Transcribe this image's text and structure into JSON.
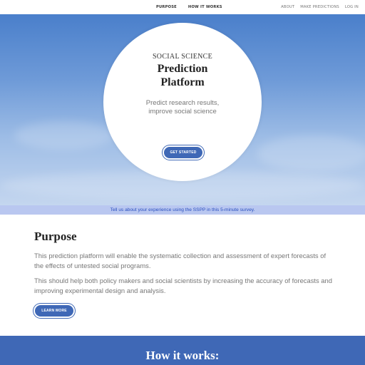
{
  "nav": {
    "center": [
      "PURPOSE",
      "HOW IT WORKS"
    ],
    "right": [
      "ABOUT",
      "MAKE PREDICTIONS",
      "LOG IN"
    ]
  },
  "hero": {
    "kicker": "SOCIAL SCIENCE",
    "title_line1": "Prediction",
    "title_line2": "Platform",
    "subtitle_line1": "Predict research results,",
    "subtitle_line2": "improve social science",
    "button": "GET STARTED"
  },
  "survey": {
    "text": "Tell us about your experience using the SSPP in this 5-minute survey."
  },
  "purpose": {
    "heading": "Purpose",
    "paragraph1": "This prediction platform will enable the systematic collection and assessment of expert forecasts of the effects of untested social programs.",
    "paragraph2": "This should help both policy makers and social scientists by increasing the accuracy of forecasts and improving experimental design and analysis.",
    "button": "LEARN MORE"
  },
  "how": {
    "heading": "How it works:"
  },
  "colors": {
    "accent": "#3f68b6",
    "survey_bg": "#b9c7f0",
    "survey_text": "#2a4fbf"
  }
}
